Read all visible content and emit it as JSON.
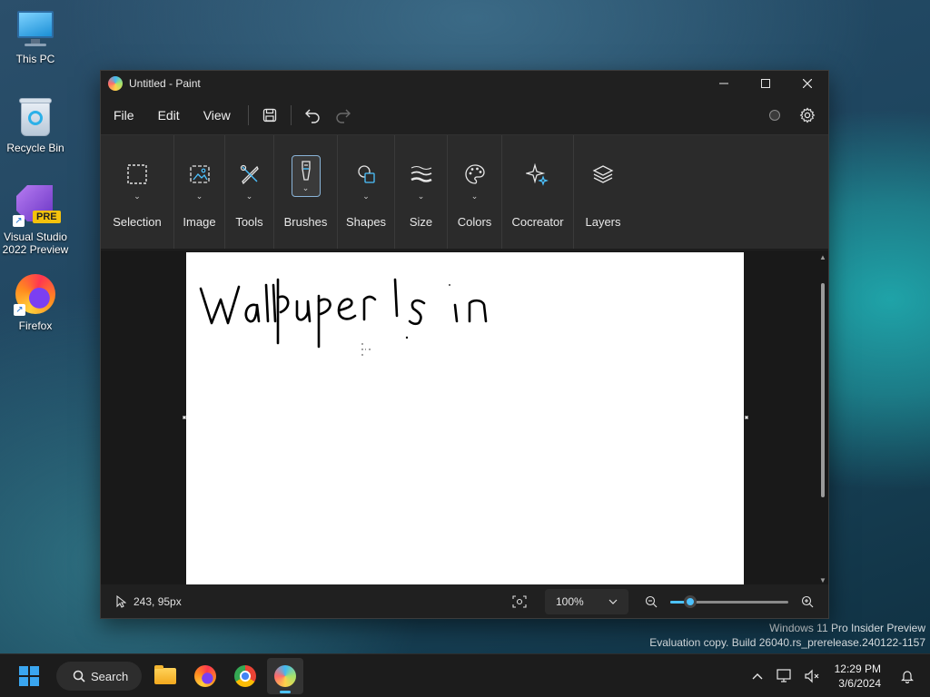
{
  "desktop": {
    "icons": [
      {
        "label": "This PC"
      },
      {
        "label": "Recycle Bin"
      },
      {
        "label": "Visual Studio 2022 Preview",
        "badge": "PRE"
      },
      {
        "label": "Firefox"
      }
    ],
    "watermark": {
      "line1": "Windows 11 Pro Insider Preview",
      "line2": "Evaluation copy. Build 26040.rs_prerelease.240122-1157"
    }
  },
  "window": {
    "title": "Untitled - Paint",
    "controls": {
      "minimize": "minimize-icon",
      "maximize": "maximize-icon",
      "close": "close-icon"
    }
  },
  "menubar": {
    "items": [
      "File",
      "Edit",
      "View"
    ],
    "icons": [
      "save-icon",
      "undo-icon",
      "redo-icon"
    ],
    "right_icons": [
      "account-icon",
      "settings-icon"
    ]
  },
  "ribbon": {
    "groups": [
      {
        "label": "Selection",
        "icon": "selection-icon"
      },
      {
        "label": "Image",
        "icon": "image-icon"
      },
      {
        "label": "Tools",
        "icon": "tools-icon"
      },
      {
        "label": "Brushes",
        "icon": "brush-icon",
        "active": true
      },
      {
        "label": "Shapes",
        "icon": "shapes-icon"
      },
      {
        "label": "Size",
        "icon": "size-icon"
      },
      {
        "label": "Colors",
        "icon": "palette-icon"
      },
      {
        "label": "Cocreator",
        "icon": "sparkle-icon"
      },
      {
        "label": "Layers",
        "icon": "layers-icon"
      }
    ]
  },
  "canvas": {
    "handwriting": "Wallpuper Is in",
    "background": "#ffffff"
  },
  "statusbar": {
    "cursor_position": "243, 95px",
    "zoom": "100%",
    "zoom_slider_fraction": 0.17
  },
  "taskbar": {
    "search_label": "Search",
    "apps": [
      "file-explorer-icon",
      "firefox-icon",
      "chrome-icon",
      "paint-icon"
    ],
    "active_app": "paint-icon",
    "clock": {
      "time": "12:29 PM",
      "date": "3/6/2024"
    }
  },
  "colors": {
    "accent": "#4cc2ff",
    "window_bg": "#202020",
    "ribbon_bg": "#2b2b2b",
    "workspace_bg": "#191919"
  }
}
